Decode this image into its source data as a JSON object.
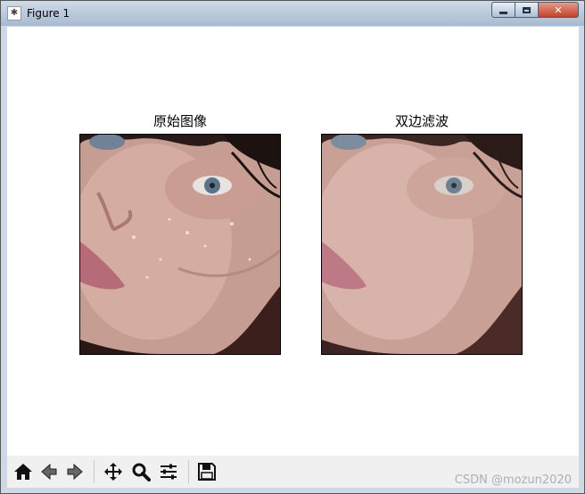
{
  "window": {
    "title": "Figure 1",
    "controls": {
      "minimize": "minimize",
      "maximize": "maximize",
      "close": "close"
    }
  },
  "figure": {
    "subplots": [
      {
        "title": "原始图像"
      },
      {
        "title": "双边滤波"
      }
    ]
  },
  "toolbar": {
    "buttons": [
      {
        "icon": "home-icon"
      },
      {
        "icon": "back-arrow-icon"
      },
      {
        "icon": "forward-arrow-icon"
      },
      {
        "icon": "pan-icon"
      },
      {
        "icon": "zoom-icon"
      },
      {
        "icon": "configure-subplots-icon"
      },
      {
        "icon": "save-icon"
      }
    ]
  },
  "watermark": "CSDN @mozun2020",
  "colors": {
    "titlebar": "#b9c8da",
    "close_button": "#c2412a",
    "toolbar_bg": "#f0f0f0",
    "skin": "#d9a9a0",
    "hair": "#2a1a17",
    "eye": "#5c7388"
  }
}
